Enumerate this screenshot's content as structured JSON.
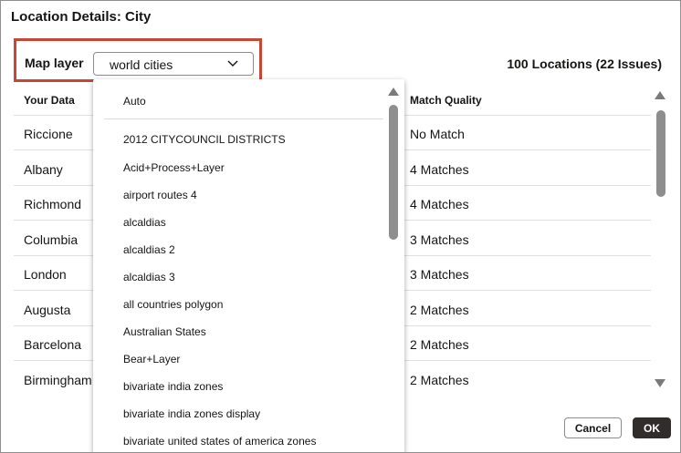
{
  "dialog": {
    "title": "Location Details: City",
    "map_layer_label": "Map layer",
    "map_layer_value": "world cities",
    "location_count": "100 Locations (22 Issues)"
  },
  "table": {
    "headers": {
      "your_data": "Your Data",
      "match_quality": "Match Quality"
    },
    "rows": [
      {
        "your_data": "Riccione",
        "match_quality": "No Match"
      },
      {
        "your_data": "Albany",
        "match_quality": "4 Matches"
      },
      {
        "your_data": "Richmond",
        "match_quality": "4 Matches"
      },
      {
        "your_data": "Columbia",
        "match_quality": "3 Matches"
      },
      {
        "your_data": "London",
        "match_quality": "3 Matches"
      },
      {
        "your_data": "Augusta",
        "match_quality": "2 Matches"
      },
      {
        "your_data": "Barcelona",
        "match_quality": "2 Matches"
      },
      {
        "your_data": "Birmingham",
        "match_quality": "2 Matches"
      }
    ]
  },
  "dropdown": {
    "options": [
      "Auto",
      "2012 CITYCOUNCIL DISTRICTS",
      "Acid+Process+Layer",
      "airport routes 4",
      "alcaldias",
      "alcaldias 2",
      "alcaldias 3",
      "all countries polygon",
      "Australian States",
      "Bear+Layer",
      "bivariate india zones",
      "bivariate india zones display",
      "bivariate united states of america zones"
    ]
  },
  "buttons": {
    "cancel": "Cancel",
    "ok": "OK"
  },
  "icons": {
    "select_chevron": "chevron-down-icon",
    "scroll_up": "scroll-up-arrow-icon",
    "scroll_down": "scroll-down-arrow-icon"
  },
  "colors": {
    "highlight": "#c74634",
    "primary_button": "#312d2a",
    "scroll_thumb": "#8e8e8e"
  }
}
